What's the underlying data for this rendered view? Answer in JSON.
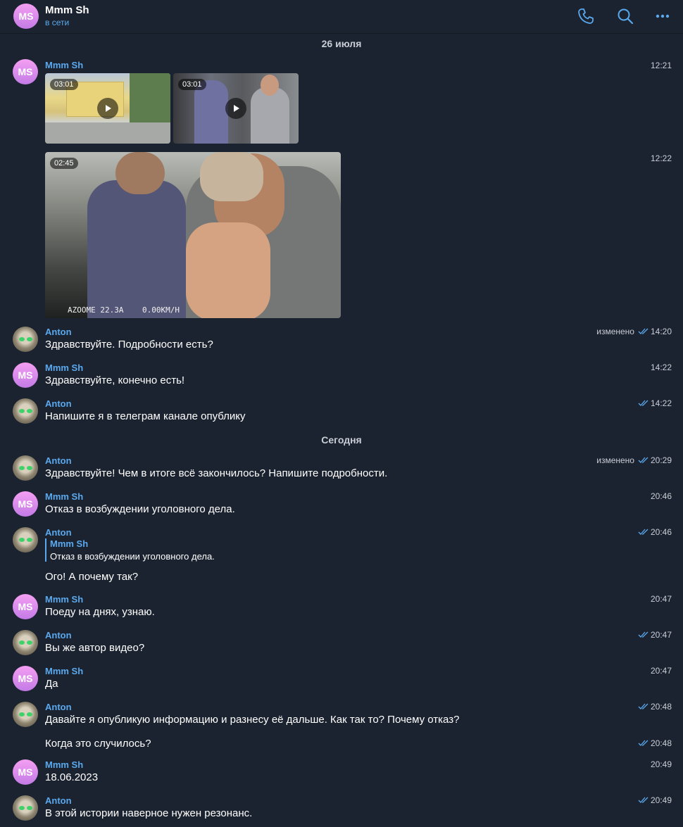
{
  "header": {
    "avatar_initials": "MS",
    "name": "Mmm Sh",
    "status": "в сети",
    "icons": [
      "phone-icon",
      "search-icon",
      "more-icon"
    ]
  },
  "colors": {
    "accent": "#5aa9ee",
    "background": "#1c2330"
  },
  "dates": {
    "first": "26 июля",
    "today": "Сегодня"
  },
  "videos": [
    {
      "duration": "03:01",
      "time": "12:21"
    },
    {
      "duration": "03:01"
    },
    {
      "duration": "02:45",
      "time": "12:22",
      "overlay_text": "AZOOME 22.3A    0.00KM/H"
    }
  ],
  "messages": [
    {
      "sender": "Mmm Sh",
      "avatar": "MS"
    },
    {
      "sender": "Anton",
      "text": "Здравствуйте. Подробности есть?",
      "edited": "изменено",
      "time": "14:20"
    },
    {
      "sender": "Mmm Sh",
      "avatar": "MS",
      "text": "Здравствуйте, конечно есть!",
      "time": "14:22"
    },
    {
      "sender": "Anton",
      "text": "Напишите я в телеграм канале опублику",
      "time": "14:22"
    },
    {
      "sender": "Anton",
      "text": "Здравствуйте! Чем в итоге всё закончилось? Напишите подробности.",
      "edited": "изменено",
      "time": "20:29"
    },
    {
      "sender": "Mmm Sh",
      "avatar": "MS",
      "text": "Отказ в возбуждении уголовного дела.",
      "time": "20:46"
    },
    {
      "sender": "Anton",
      "reply_name": "Mmm Sh",
      "reply_text": "Отказ в возбуждении уголовного дела.",
      "text": "Ого! А почему так?",
      "time": "20:46"
    },
    {
      "sender": "Mmm Sh",
      "avatar": "MS",
      "text": "Поеду на днях, узнаю.",
      "time": "20:47"
    },
    {
      "sender": "Anton",
      "text": "Вы же автор видео?",
      "time": "20:47"
    },
    {
      "sender": "Mmm Sh",
      "avatar": "MS",
      "text": "Да",
      "time": "20:47"
    },
    {
      "sender": "Anton",
      "text": "Давайте я опубликую информацию и разнесу её дальше. Как так то? Почему отказ?",
      "time": "20:48"
    },
    {
      "text": "Когда это случилось?",
      "time": "20:48"
    },
    {
      "sender": "Mmm Sh",
      "avatar": "MS",
      "text": "18.06.2023",
      "time": "20:49"
    },
    {
      "sender": "Anton",
      "text": "В этой истории наверное нужен резонанс.",
      "time": "20:49"
    }
  ]
}
